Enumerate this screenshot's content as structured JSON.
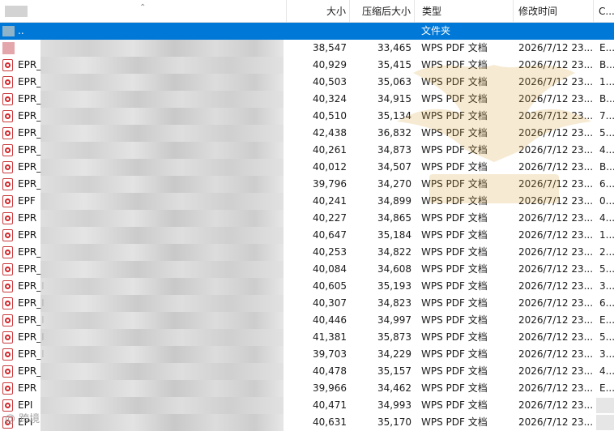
{
  "header": {
    "size": "大小",
    "compressed": "压缩后大小",
    "type": "类型",
    "modified": "修改时间",
    "crc": "C..."
  },
  "rows": [
    {
      "icon": "folder-icon",
      "name": "..",
      "size": "",
      "compressed": "",
      "type": "文件夹",
      "date": "",
      "crc": "",
      "selected": true
    },
    {
      "icon": "file-icon",
      "name": "",
      "size": "38,547",
      "compressed": "33,465",
      "type": "WPS PDF 文档",
      "date": "2026/7/12 23...",
      "crc": "E..."
    },
    {
      "icon": "pdf-file-icon",
      "name": "EPR_",
      "size": "40,929",
      "compressed": "35,415",
      "type": "WPS PDF 文档",
      "date": "2026/7/12 23...",
      "crc": "B..."
    },
    {
      "icon": "pdf-file-icon",
      "name": "EPR_",
      "size": "40,503",
      "compressed": "35,063",
      "type": "WPS PDF 文档",
      "date": "2026/7/12 23...",
      "crc": "1..."
    },
    {
      "icon": "pdf-file-icon",
      "name": "EPR_",
      "size": "40,324",
      "compressed": "34,915",
      "type": "WPS PDF 文档",
      "date": "2026/7/12 23...",
      "crc": "B..."
    },
    {
      "icon": "pdf-file-icon",
      "name": "EPR_",
      "size": "40,510",
      "compressed": "35,134",
      "type": "WPS PDF 文档",
      "date": "2026/7/12 23...",
      "crc": "7..."
    },
    {
      "icon": "pdf-file-icon",
      "name": "EPR_",
      "size": "42,438",
      "compressed": "36,832",
      "type": "WPS PDF 文档",
      "date": "2026/7/12 23...",
      "crc": "5..."
    },
    {
      "icon": "pdf-file-icon",
      "name": "EPR_",
      "size": "40,261",
      "compressed": "34,873",
      "type": "WPS PDF 文档",
      "date": "2026/7/12 23...",
      "crc": "4..."
    },
    {
      "icon": "pdf-file-icon",
      "name": "EPR_",
      "size": "40,012",
      "compressed": "34,507",
      "type": "WPS PDF 文档",
      "date": "2026/7/12 23...",
      "crc": "B..."
    },
    {
      "icon": "pdf-file-icon",
      "name": "EPR_",
      "size": "39,796",
      "compressed": "34,270",
      "type": "WPS PDF 文档",
      "date": "2026/7/12 23...",
      "crc": "6..."
    },
    {
      "icon": "pdf-file-icon",
      "name": "EPF",
      "size": "40,241",
      "compressed": "34,899",
      "type": "WPS PDF 文档",
      "date": "2026/7/12 23...",
      "crc": "0..."
    },
    {
      "icon": "pdf-file-icon",
      "name": "EPR",
      "size": "40,227",
      "compressed": "34,865",
      "type": "WPS PDF 文档",
      "date": "2026/7/12 23...",
      "crc": "4..."
    },
    {
      "icon": "pdf-file-icon",
      "name": "EPR",
      "size": "40,647",
      "compressed": "35,184",
      "type": "WPS PDF 文档",
      "date": "2026/7/12 23...",
      "crc": "1..."
    },
    {
      "icon": "pdf-file-icon",
      "name": "EPR_",
      "size": "40,253",
      "compressed": "34,822",
      "type": "WPS PDF 文档",
      "date": "2026/7/12 23...",
      "crc": "2..."
    },
    {
      "icon": "pdf-file-icon",
      "name": "EPR_",
      "size": "40,084",
      "compressed": "34,608",
      "type": "WPS PDF 文档",
      "date": "2026/7/12 23...",
      "crc": "5..."
    },
    {
      "icon": "pdf-file-icon",
      "name": "EPR_I",
      "size": "40,605",
      "compressed": "35,193",
      "type": "WPS PDF 文档",
      "date": "2026/7/12 23...",
      "crc": "3..."
    },
    {
      "icon": "pdf-file-icon",
      "name": "EPR_I",
      "size": "40,307",
      "compressed": "34,823",
      "type": "WPS PDF 文档",
      "date": "2026/7/12 23...",
      "crc": "6..."
    },
    {
      "icon": "pdf-file-icon",
      "name": "EPR_I",
      "size": "40,446",
      "compressed": "34,997",
      "type": "WPS PDF 文档",
      "date": "2026/7/12 23...",
      "crc": "E..."
    },
    {
      "icon": "pdf-file-icon",
      "name": "EPR_I",
      "size": "41,381",
      "compressed": "35,873",
      "type": "WPS PDF 文档",
      "date": "2026/7/12 23...",
      "crc": "5..."
    },
    {
      "icon": "pdf-file-icon",
      "name": "EPR_I",
      "size": "39,703",
      "compressed": "34,229",
      "type": "WPS PDF 文档",
      "date": "2026/7/12 23...",
      "crc": "3..."
    },
    {
      "icon": "pdf-file-icon",
      "name": "EPR_",
      "size": "40,478",
      "compressed": "35,157",
      "type": "WPS PDF 文档",
      "date": "2026/7/12 23...",
      "crc": "4..."
    },
    {
      "icon": "pdf-file-icon",
      "name": "EPR",
      "size": "39,966",
      "compressed": "34,462",
      "type": "WPS PDF 文档",
      "date": "2026/7/12 23...",
      "crc": "E..."
    },
    {
      "icon": "pdf-file-icon",
      "name": "EPI",
      "size": "40,471",
      "compressed": "34,993",
      "type": "WPS PDF 文档",
      "date": "2026/7/12 23...",
      "crc": ""
    },
    {
      "icon": "pdf-file-icon",
      "name": "EPI",
      "size": "40,631",
      "compressed": "35,170",
      "type": "WPS PDF 文档",
      "date": "2026/7/12 23...",
      "crc": ""
    }
  ],
  "watermark": {
    "text": "@ 跨境"
  },
  "colors": {
    "selection": "#0078d7",
    "pdf_icon": "#d2272c"
  }
}
